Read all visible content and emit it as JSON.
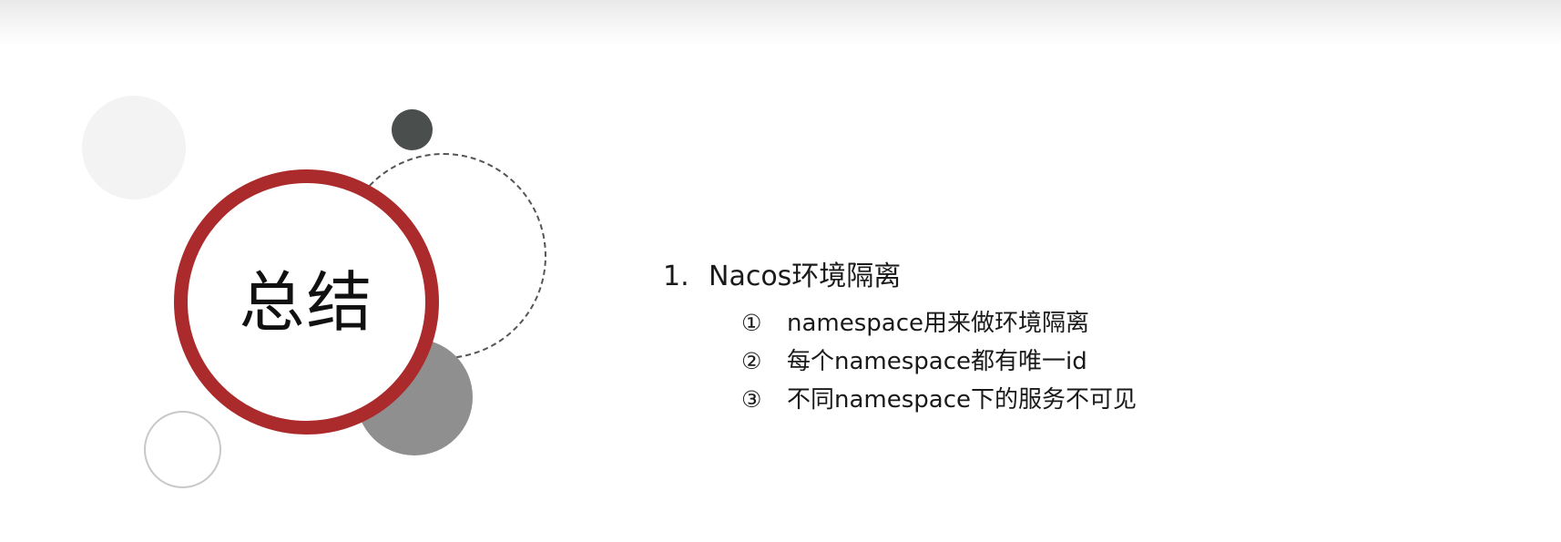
{
  "slide": {
    "title": "总结",
    "heading": {
      "number": "1.",
      "text": "Nacos环境隔离"
    },
    "items": [
      {
        "marker": "①",
        "text": "namespace用来做环境隔离"
      },
      {
        "marker": "②",
        "text": "每个namespace都有唯一id"
      },
      {
        "marker": "③",
        "text": "不同namespace下的服务不可见"
      }
    ]
  },
  "colors": {
    "accent_red": "#ab2a2b",
    "dark_circle": "#4a4e4d",
    "mid_gray_circle": "#8f8f8f",
    "light_gray_circle": "#f3f3f3",
    "text": "#1a1a1a"
  }
}
